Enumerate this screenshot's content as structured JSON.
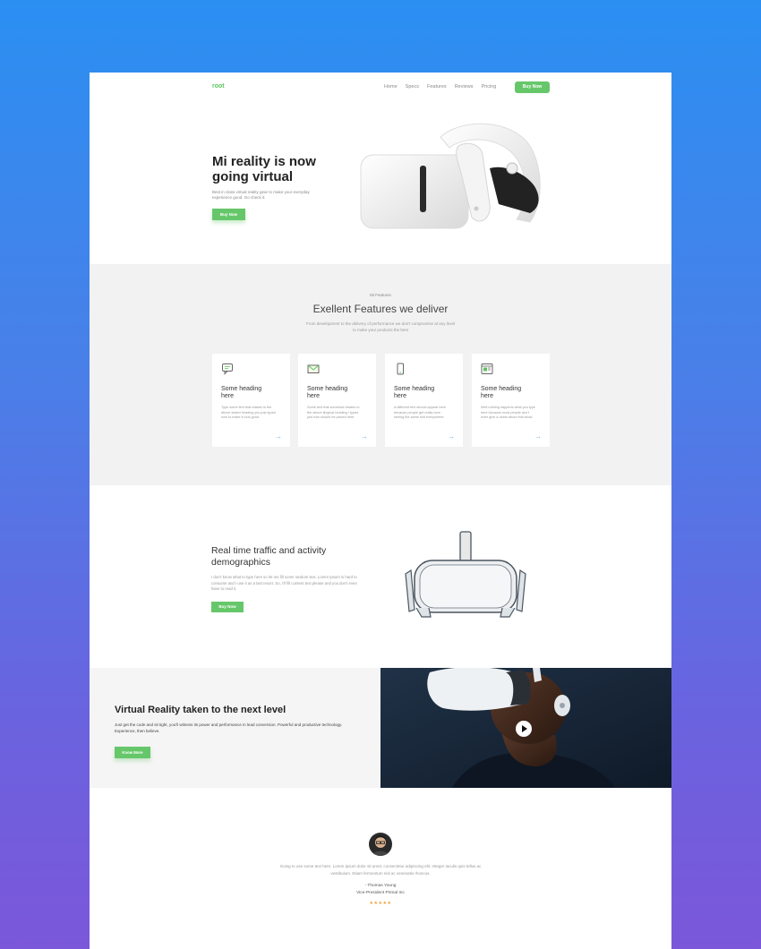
{
  "nav": {
    "logo": "root",
    "links": [
      "Home",
      "Specs",
      "Features",
      "Reviews",
      "Pricing"
    ],
    "cta": "Buy Now"
  },
  "hero": {
    "title": "Mi reality is now going virtual",
    "description": "Best in class virtual reality gear to make your everyday experience good. Go check it.",
    "button": "Buy Now"
  },
  "features": {
    "eyebrow": "Mi Features",
    "title": "Exellent Features we deliver",
    "subtitle": "From development to the delivery of performance we don't compromise at any level to make your products the best",
    "cards": [
      {
        "icon": "chat-icon",
        "heading": "Some heading here",
        "text": "Type some text that relates to the above stated heading you just typed now to make it look good."
      },
      {
        "icon": "mail-icon",
        "heading": "Some heading here",
        "text": "Some text that somehow relates to the above illogical heading I typed just now should be placed here."
      },
      {
        "icon": "phone-icon",
        "heading": "Some heading here",
        "text": "A different text should appear here because people get really bore seeing the same shit everywhere."
      },
      {
        "icon": "browser-icon",
        "heading": "Some heading here",
        "text": "Well nothing happens what you type here because most people don't even give a damn about this block."
      }
    ]
  },
  "traffic": {
    "title": "Real time traffic and activity demographics",
    "description": "I don't know what to type here so let me fill some random text. Lorem Ipsum is hard to consume and I use it as a last resort. So, I'll fill content text please and you don't even have to read it.",
    "button": "Buy Now"
  },
  "vr_band": {
    "title": "Virtual Reality taken to the next level",
    "description": "Just get the code and sit tight, you'll witness its power and performance in lead conversion. Powerful and productive technology. Experience, then believe.",
    "button": "Know More"
  },
  "testimonial": {
    "quote": "Going to use some text here. Lorem ipsum dolor sit amet, consectetur adipiscing elit. Integer iaculis quis tellus ac vestibulum. Etiam fermentum nisl ac venenatis rhoncus.",
    "name": "- Thomas Young",
    "role": "Vice-President Primal Inc",
    "rating": "★★★★★"
  },
  "colors": {
    "accent": "#66c76a",
    "background_top": "#2b8ff2",
    "background_bottom": "#7b57da"
  }
}
